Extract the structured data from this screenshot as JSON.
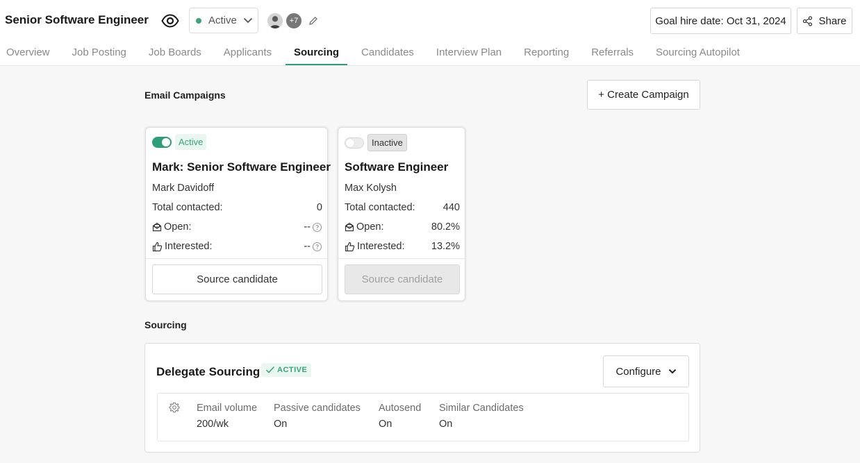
{
  "header": {
    "job_title": "Senior Software Engineer",
    "status": "Active",
    "extra_members": "+7",
    "goal_hire_date": "Goal hire date: Oct 31, 2024",
    "share_label": "Share"
  },
  "tabs": [
    {
      "label": "Overview"
    },
    {
      "label": "Job Posting"
    },
    {
      "label": "Job Boards"
    },
    {
      "label": "Applicants"
    },
    {
      "label": "Sourcing",
      "active": true
    },
    {
      "label": "Candidates"
    },
    {
      "label": "Interview Plan"
    },
    {
      "label": "Reporting"
    },
    {
      "label": "Referrals"
    },
    {
      "label": "Sourcing Autopilot"
    }
  ],
  "email_campaigns": {
    "title": "Email Campaigns",
    "create_label": "+ Create Campaign",
    "cards": [
      {
        "status": "Active",
        "title": "Mark: Senior Software Engineer",
        "owner": "Mark Davidoff",
        "total_label": "Total contacted:",
        "total_value": "0",
        "open_label": "Open:",
        "open_value": "--",
        "interested_label": "Interested:",
        "interested_value": "--",
        "source_label": "Source candidate"
      },
      {
        "status": "Inactive",
        "title": "Software Engineer",
        "owner": "Max Kolysh",
        "total_label": "Total contacted:",
        "total_value": "440",
        "open_label": "Open:",
        "open_value": "80.2%",
        "interested_label": "Interested:",
        "interested_value": "13.2%",
        "source_label": "Source candidate"
      }
    ]
  },
  "sourcing": {
    "title": "Sourcing",
    "delegate_title": "Delegate Sourcing",
    "delegate_badge": "ACTIVE",
    "configure_label": "Configure",
    "settings": [
      {
        "label": "Email volume",
        "value": "200/wk"
      },
      {
        "label": "Passive candidates",
        "value": "On"
      },
      {
        "label": "Autosend",
        "value": "On"
      },
      {
        "label": "Similar Candidates",
        "value": "On"
      }
    ]
  },
  "colors": {
    "accent": "#2f9e78",
    "active_text": "#3aa378"
  },
  "icons": [
    "eye-icon",
    "chevron-down-icon",
    "pencil-icon",
    "share-icon",
    "mail-open-icon",
    "thumbs-up-icon",
    "help-circle-icon",
    "check-icon",
    "gear-icon"
  ]
}
